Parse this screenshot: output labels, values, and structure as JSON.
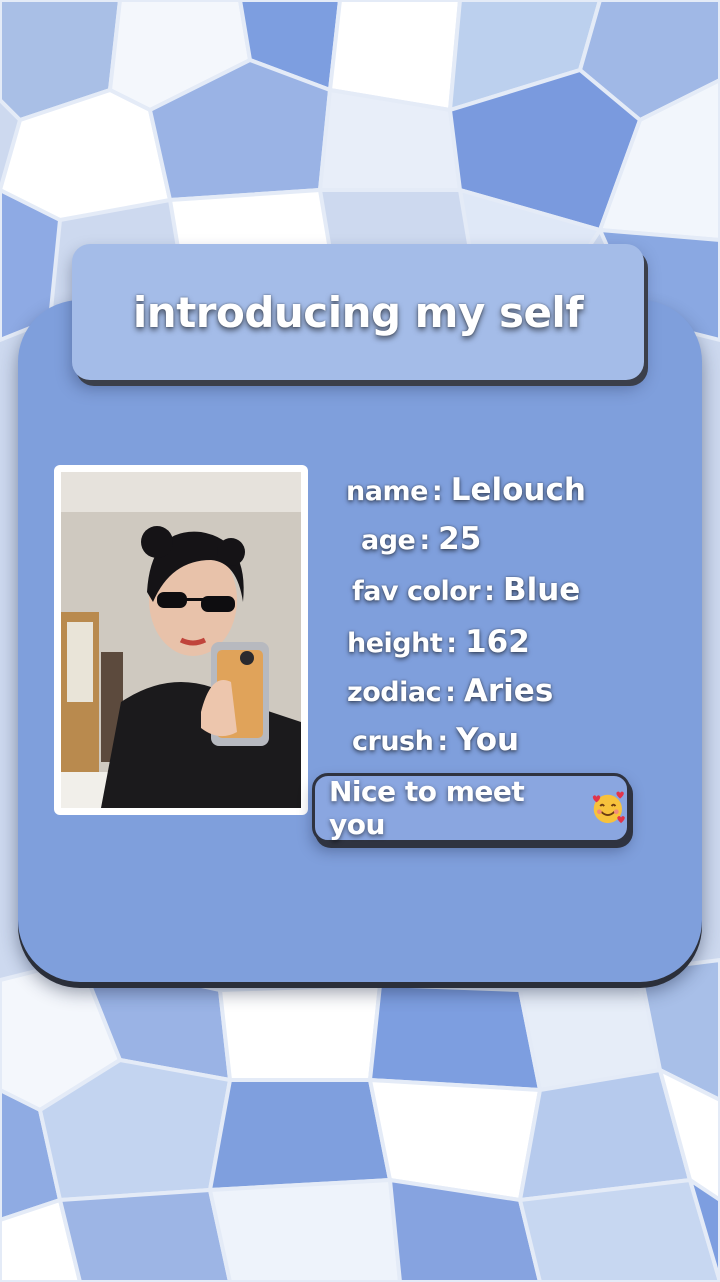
{
  "title": "introducing my self",
  "profile": {
    "rows": [
      {
        "label": "name",
        "value": "Lelouch"
      },
      {
        "label": "age",
        "value": "25"
      },
      {
        "label": "fav color",
        "value": "Blue"
      },
      {
        "label": "height",
        "value": "162"
      },
      {
        "label": "zodiac",
        "value": "Aries"
      },
      {
        "label": "crush",
        "value": "You"
      }
    ],
    "separator": ":"
  },
  "greeting": "Nice to meet you",
  "greeting_emoji": "smiling-face-with-hearts-icon",
  "colors": {
    "card": "#7f9fdc",
    "title_box": "#a4bce8",
    "greeting_box": "#8aa6e0",
    "text": "#ffffff"
  }
}
